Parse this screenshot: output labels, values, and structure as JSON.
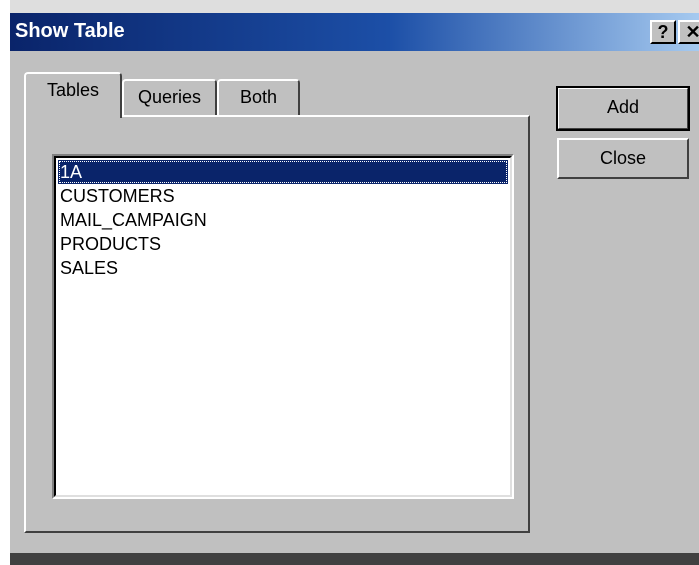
{
  "window": {
    "title": "Show Table",
    "help_label": "?",
    "close_label": "✕"
  },
  "tabs": [
    {
      "label": "Tables",
      "selected": true
    },
    {
      "label": "Queries",
      "selected": false
    },
    {
      "label": "Both",
      "selected": false
    }
  ],
  "list": {
    "items": [
      "1A",
      "CUSTOMERS",
      "MAIL_CAMPAIGN",
      "PRODUCTS",
      "SALES"
    ],
    "selected_index": 0
  },
  "buttons": {
    "add_label": "Add",
    "close_label": "Close"
  },
  "colors": {
    "titlebar_start": "#0a246a",
    "titlebar_end": "#a6caf0",
    "dialog_bg": "#c0c0c0",
    "selection": "#0a246a"
  }
}
